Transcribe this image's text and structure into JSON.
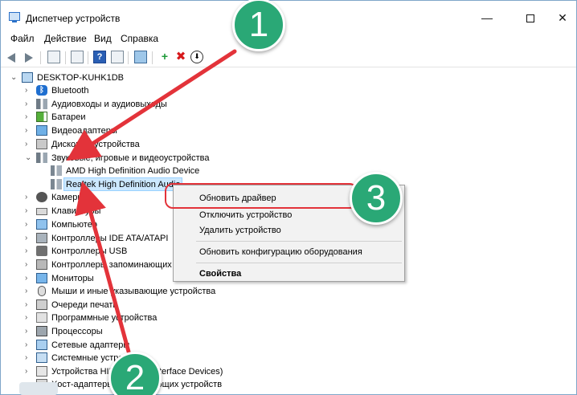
{
  "window": {
    "title": "Диспетчер устройств",
    "controls": {
      "minimize": "—",
      "maximize": "",
      "close": "✕"
    }
  },
  "menu": [
    "Файл",
    "Действие",
    "Вид",
    "Справка"
  ],
  "toolbar": {
    "help_glyph": "?",
    "add_glyph": "+",
    "remove_glyph": "✖",
    "download_glyph": "⬇"
  },
  "tree": {
    "root": "DESKTOP-KUHK1DB",
    "items": [
      {
        "label": "Bluetooth",
        "icon": "bluetooth-icon"
      },
      {
        "label": "Аудиовходы и аудиовыходы",
        "icon": "audio-io-icon"
      },
      {
        "label": "Батареи",
        "icon": "battery-icon"
      },
      {
        "label": "Видеоадаптеры",
        "icon": "display-adapter-icon"
      },
      {
        "label": "Дисковые устройства",
        "icon": "disk-drive-icon"
      },
      {
        "label": "Звуковые, игровые и видеоустройства",
        "icon": "sound-icon",
        "expanded": true,
        "children": [
          {
            "label": "AMD High Definition Audio Device",
            "icon": "speaker-icon"
          },
          {
            "label": "Realtek High Definition Audio",
            "icon": "speaker-icon",
            "selected": true
          }
        ]
      },
      {
        "label": "Камеры",
        "icon": "camera-icon"
      },
      {
        "label": "Клавиатуры",
        "icon": "keyboard-icon"
      },
      {
        "label": "Компьютер",
        "icon": "computer-icon"
      },
      {
        "label": "Контроллеры IDE ATA/ATAPI",
        "icon": "ide-controller-icon"
      },
      {
        "label": "Контроллеры USB",
        "icon": "usb-icon"
      },
      {
        "label": "Контроллеры запоминающих устройств",
        "icon": "storage-controller-icon"
      },
      {
        "label": "Мониторы",
        "icon": "monitor-icon"
      },
      {
        "label": "Мыши и иные указывающие устройства",
        "icon": "mouse-icon"
      },
      {
        "label": "Очереди печати",
        "icon": "printer-icon"
      },
      {
        "label": "Программные устройства",
        "icon": "software-device-icon"
      },
      {
        "label": "Процессоры",
        "icon": "cpu-icon"
      },
      {
        "label": "Сетевые адаптеры",
        "icon": "network-adapter-icon"
      },
      {
        "label": "Системные устройства",
        "icon": "system-device-icon"
      },
      {
        "label": "Устройства HID (Human Interface Devices)",
        "icon": "hid-icon"
      },
      {
        "label": "Хост-адаптеры запоминающих устройств",
        "icon": "storage-host-icon"
      }
    ]
  },
  "context_menu": {
    "items": [
      {
        "label": "Обновить драйвер"
      },
      {
        "label": "Отключить устройство"
      },
      {
        "label": "Удалить устройство"
      },
      {
        "label": "Обновить конфигурацию оборудования"
      },
      {
        "label": "Свойства",
        "bold": true
      }
    ]
  },
  "annotations": {
    "callouts": [
      "1",
      "2",
      "3"
    ],
    "color_callout": "#2aa876",
    "color_arrow": "#e3333a"
  }
}
